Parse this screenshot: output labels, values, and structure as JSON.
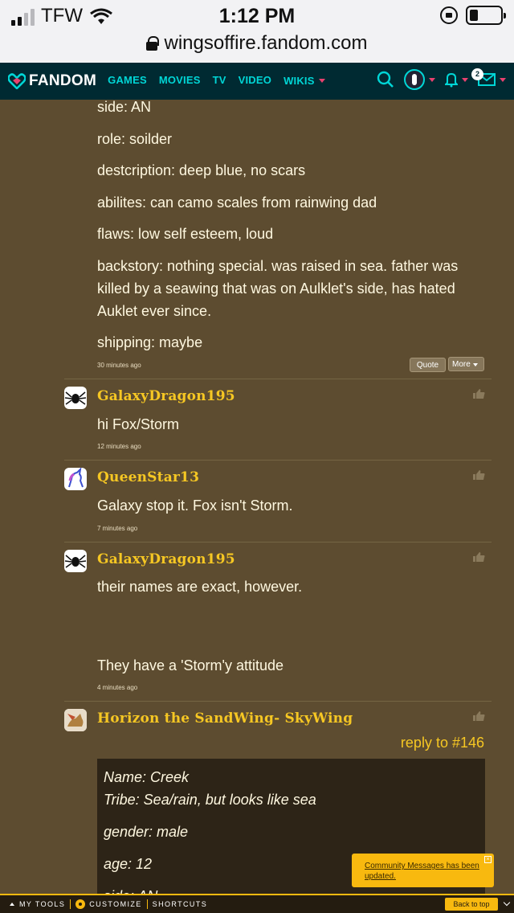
{
  "status_bar": {
    "carrier": "TFW",
    "time": "1:12 PM",
    "url": "wingsoffire.fandom.com"
  },
  "nav": {
    "logo": "FANDOM",
    "links": [
      "GAMES",
      "MOVIES",
      "TV",
      "VIDEO",
      "WIKIS"
    ],
    "mail_count": "2",
    "accent": "#00d6d6"
  },
  "post_top": {
    "lines": [
      "side: AN",
      "role: soilder",
      "destcription: deep blue, no scars",
      "abilites: can camo scales from rainwing dad",
      "flaws: low self esteem, loud",
      "backstory: nothing special. was raised in sea. father was killed by a seawing that was on Aulklet's side, has hated Auklet ever since.",
      "shipping: maybe"
    ],
    "time": "30 minutes ago",
    "quote_label": "Quote",
    "more_label": "More"
  },
  "comments": [
    {
      "user": "GalaxyDragon195",
      "text": "hi Fox/Storm",
      "time": "12 minutes ago"
    },
    {
      "user": "QueenStar13",
      "text": "Galaxy stop it. Fox isn't Storm.",
      "time": "7 minutes ago"
    },
    {
      "user": "GalaxyDragon195",
      "text": "their names are exact, however.",
      "text2": "They have a 'Storm'y attitude",
      "time": "4 minutes ago"
    },
    {
      "user": "Horizon the SandWing- SkyWing",
      "reply_to": "reply to #146"
    }
  ],
  "quote_block": {
    "lines": [
      "Name: Creek",
      "Tribe: Sea/rain, but looks like sea",
      "gender: male",
      "age: 12",
      "side: AN"
    ]
  },
  "toast": {
    "text": "Community Messages has been updated."
  },
  "toolbar": {
    "my_tools": "MY TOOLS",
    "customize": "CUSTOMIZE",
    "shortcuts": "SHORTCUTS",
    "back_to_top": "Back to top"
  },
  "colors": {
    "background": "#5d4c30",
    "username": "#f6c723",
    "fandom_bar": "#002a32",
    "toast": "#f8b90f"
  }
}
